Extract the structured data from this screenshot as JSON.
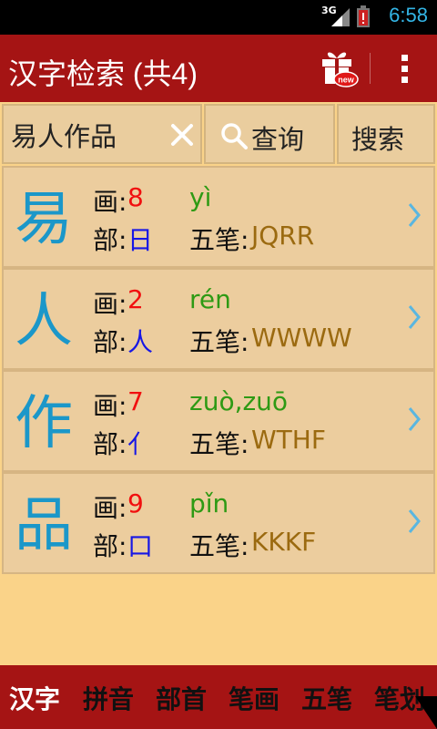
{
  "statusbar": {
    "network": "3G",
    "time": "6:58"
  },
  "actionbar": {
    "title": "汉字检索 (共4)",
    "gift_badge": "new"
  },
  "search": {
    "value": "易人作品",
    "query_label": "查询",
    "search_label": "搜索"
  },
  "results": [
    {
      "char": "易",
      "strokes_label": "画:",
      "strokes": "8",
      "radical_label": "部:",
      "radical": "日",
      "pinyin": "yì",
      "wubi_label": "五笔:",
      "wubi": "JQRR"
    },
    {
      "char": "人",
      "strokes_label": "画:",
      "strokes": "2",
      "radical_label": "部:",
      "radical": "人",
      "pinyin": "rén",
      "wubi_label": "五笔:",
      "wubi": "WWWW"
    },
    {
      "char": "作",
      "strokes_label": "画:",
      "strokes": "7",
      "radical_label": "部:",
      "radical": "亻",
      "pinyin": "zuò,zuō",
      "wubi_label": "五笔:",
      "wubi": "WTHF"
    },
    {
      "char": "品",
      "strokes_label": "画:",
      "strokes": "9",
      "radical_label": "部:",
      "radical": "口",
      "pinyin": "pǐn",
      "wubi_label": "五笔:",
      "wubi": "KKKF"
    }
  ],
  "tabs": [
    {
      "label": "汉字",
      "active": true
    },
    {
      "label": "拼音",
      "active": false
    },
    {
      "label": "部首",
      "active": false
    },
    {
      "label": "笔画",
      "active": false
    },
    {
      "label": "五笔",
      "active": false
    },
    {
      "label": "笔划",
      "active": false
    }
  ],
  "colors": {
    "accent": "#a51414",
    "background": "#fad389",
    "char": "#1b97c9",
    "strokes": "#f10f0f",
    "radical": "#1717e5",
    "pinyin": "#2e9a14",
    "wubi": "#9b6a10"
  },
  "icons": {
    "gift": "gift-icon",
    "overflow": "overflow-menu-icon",
    "clear": "close-icon",
    "search": "search-icon",
    "chevron": "chevron-right-icon"
  }
}
